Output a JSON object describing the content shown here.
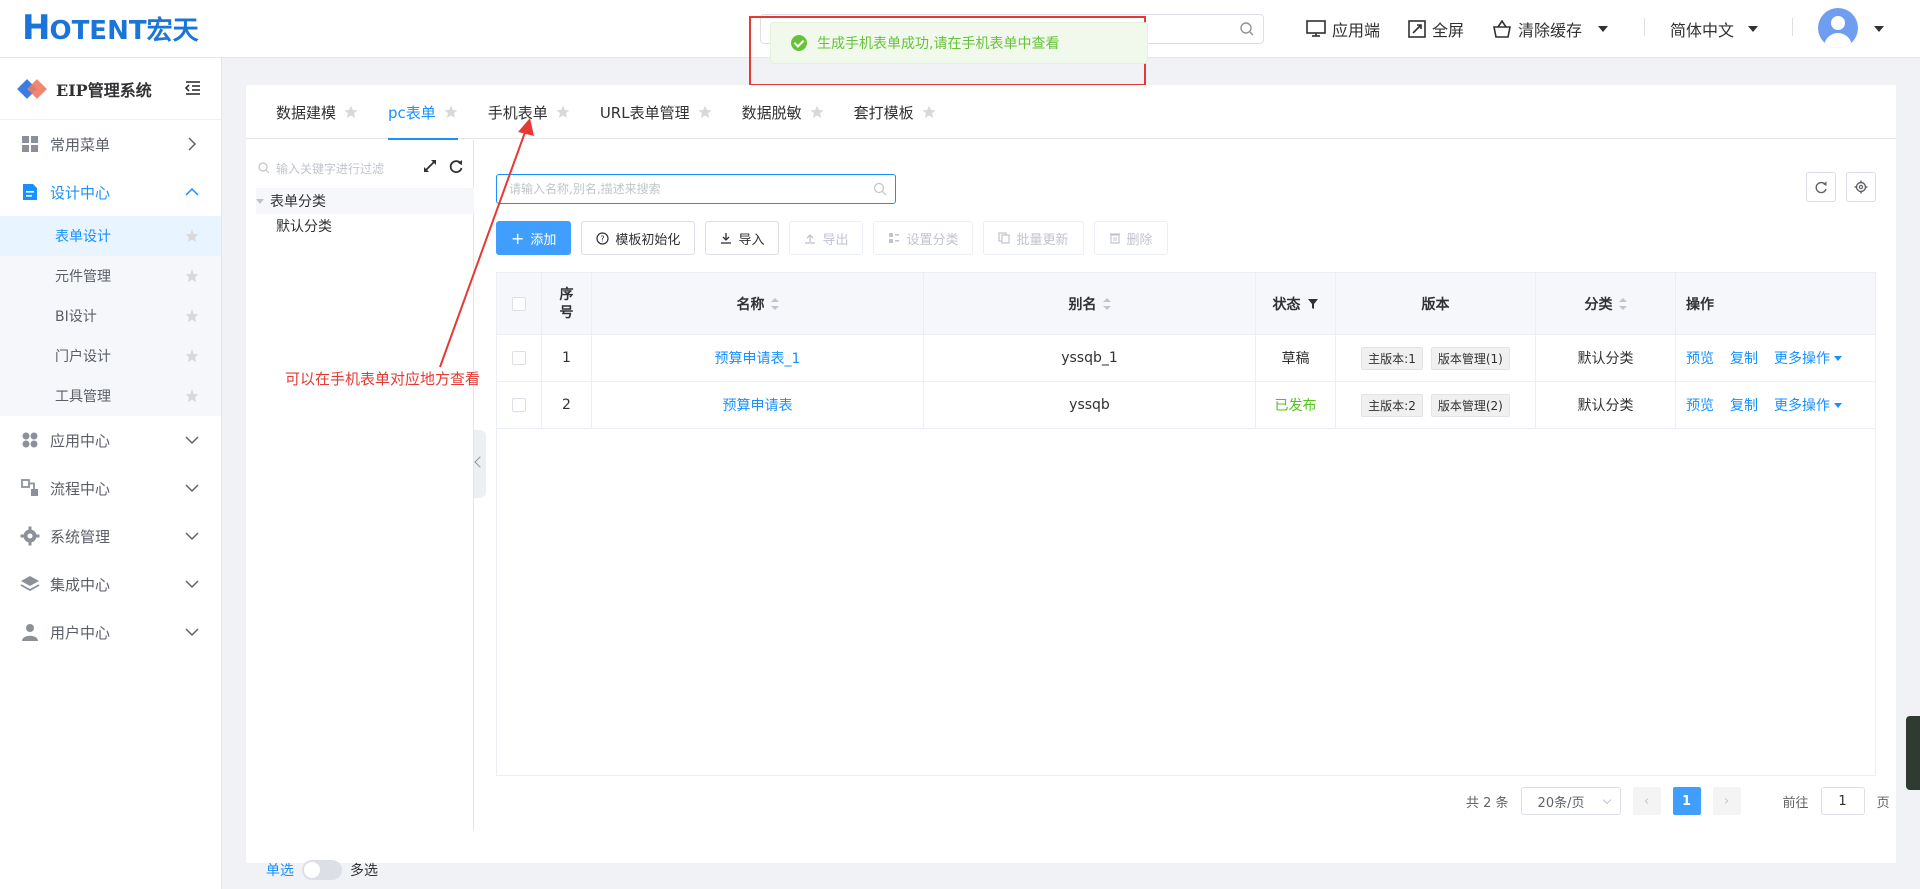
{
  "header": {
    "logo_h": "H",
    "logo_rest": "OTENT宏天",
    "actions": {
      "app_client": "应用端",
      "fullscreen": "全屏",
      "clear_cache": "清除缓存",
      "language": "简体中文"
    }
  },
  "toast": {
    "message": "生成手机表单成功,请在手机表单中查看",
    "color": "#67c23a"
  },
  "sidebar": {
    "title": "EIP管理系统",
    "items": [
      {
        "label": "常用菜单",
        "icon": "dashboard-icon",
        "state": "collapsed-right"
      },
      {
        "label": "设计中心",
        "icon": "design-icon",
        "state": "expanded"
      },
      {
        "label": "应用中心",
        "icon": "apps-icon",
        "state": "collapsed"
      },
      {
        "label": "流程中心",
        "icon": "flow-icon",
        "state": "collapsed"
      },
      {
        "label": "系统管理",
        "icon": "gear-icon",
        "state": "collapsed"
      },
      {
        "label": "集成中心",
        "icon": "layers-icon",
        "state": "collapsed"
      },
      {
        "label": "用户中心",
        "icon": "user-icon",
        "state": "collapsed"
      }
    ],
    "sub_items": [
      "表单设计",
      "元件管理",
      "BI设计",
      "门户设计",
      "工具管理"
    ],
    "active_sub": "表单设计"
  },
  "tabs": [
    "数据建模",
    "pc表单",
    "手机表单",
    "URL表单管理",
    "数据脱敏",
    "套打模板"
  ],
  "active_tab": "pc表单",
  "tree": {
    "search_placeholder": "输入关键字进行过滤",
    "root": "表单分类",
    "child": "默认分类",
    "mode_single": "单选",
    "mode_multi": "多选"
  },
  "main": {
    "search_placeholder": "请输入名称,别名,描述来搜索",
    "toolbar": {
      "add": "添加",
      "template_init": "模板初始化",
      "import": "导入",
      "export": "导出",
      "set_category": "设置分类",
      "batch_update": "批量更新",
      "delete": "删除"
    },
    "columns": {
      "no": "序号",
      "name": "名称",
      "alias": "别名",
      "status": "状态",
      "version": "版本",
      "category": "分类",
      "ops": "操作"
    },
    "rows": [
      {
        "no": "1",
        "name": "预算申请表_1",
        "alias": "yssqb_1",
        "status": "草稿",
        "main_ver": "主版本:1",
        "ver_mgmt": "版本管理(1)",
        "category": "默认分类",
        "preview": "预览",
        "copy": "复制",
        "more": "更多操作"
      },
      {
        "no": "2",
        "name": "预算申请表",
        "alias": "yssqb",
        "status": "已发布",
        "main_ver": "主版本:2",
        "ver_mgmt": "版本管理(2)",
        "category": "默认分类",
        "preview": "预览",
        "copy": "复制",
        "more": "更多操作"
      }
    ],
    "pager": {
      "total": "共 2 条",
      "page_size": "20条/页",
      "current": "1",
      "goto_prefix": "前往",
      "goto_value": "1",
      "goto_suffix": "页"
    }
  },
  "annotation": "可以在手机表单对应地方查看",
  "colors": {
    "primary": "#1890ff",
    "button_primary": "#409eff",
    "annotation_red": "#e53935",
    "published_green": "#52c41a"
  }
}
